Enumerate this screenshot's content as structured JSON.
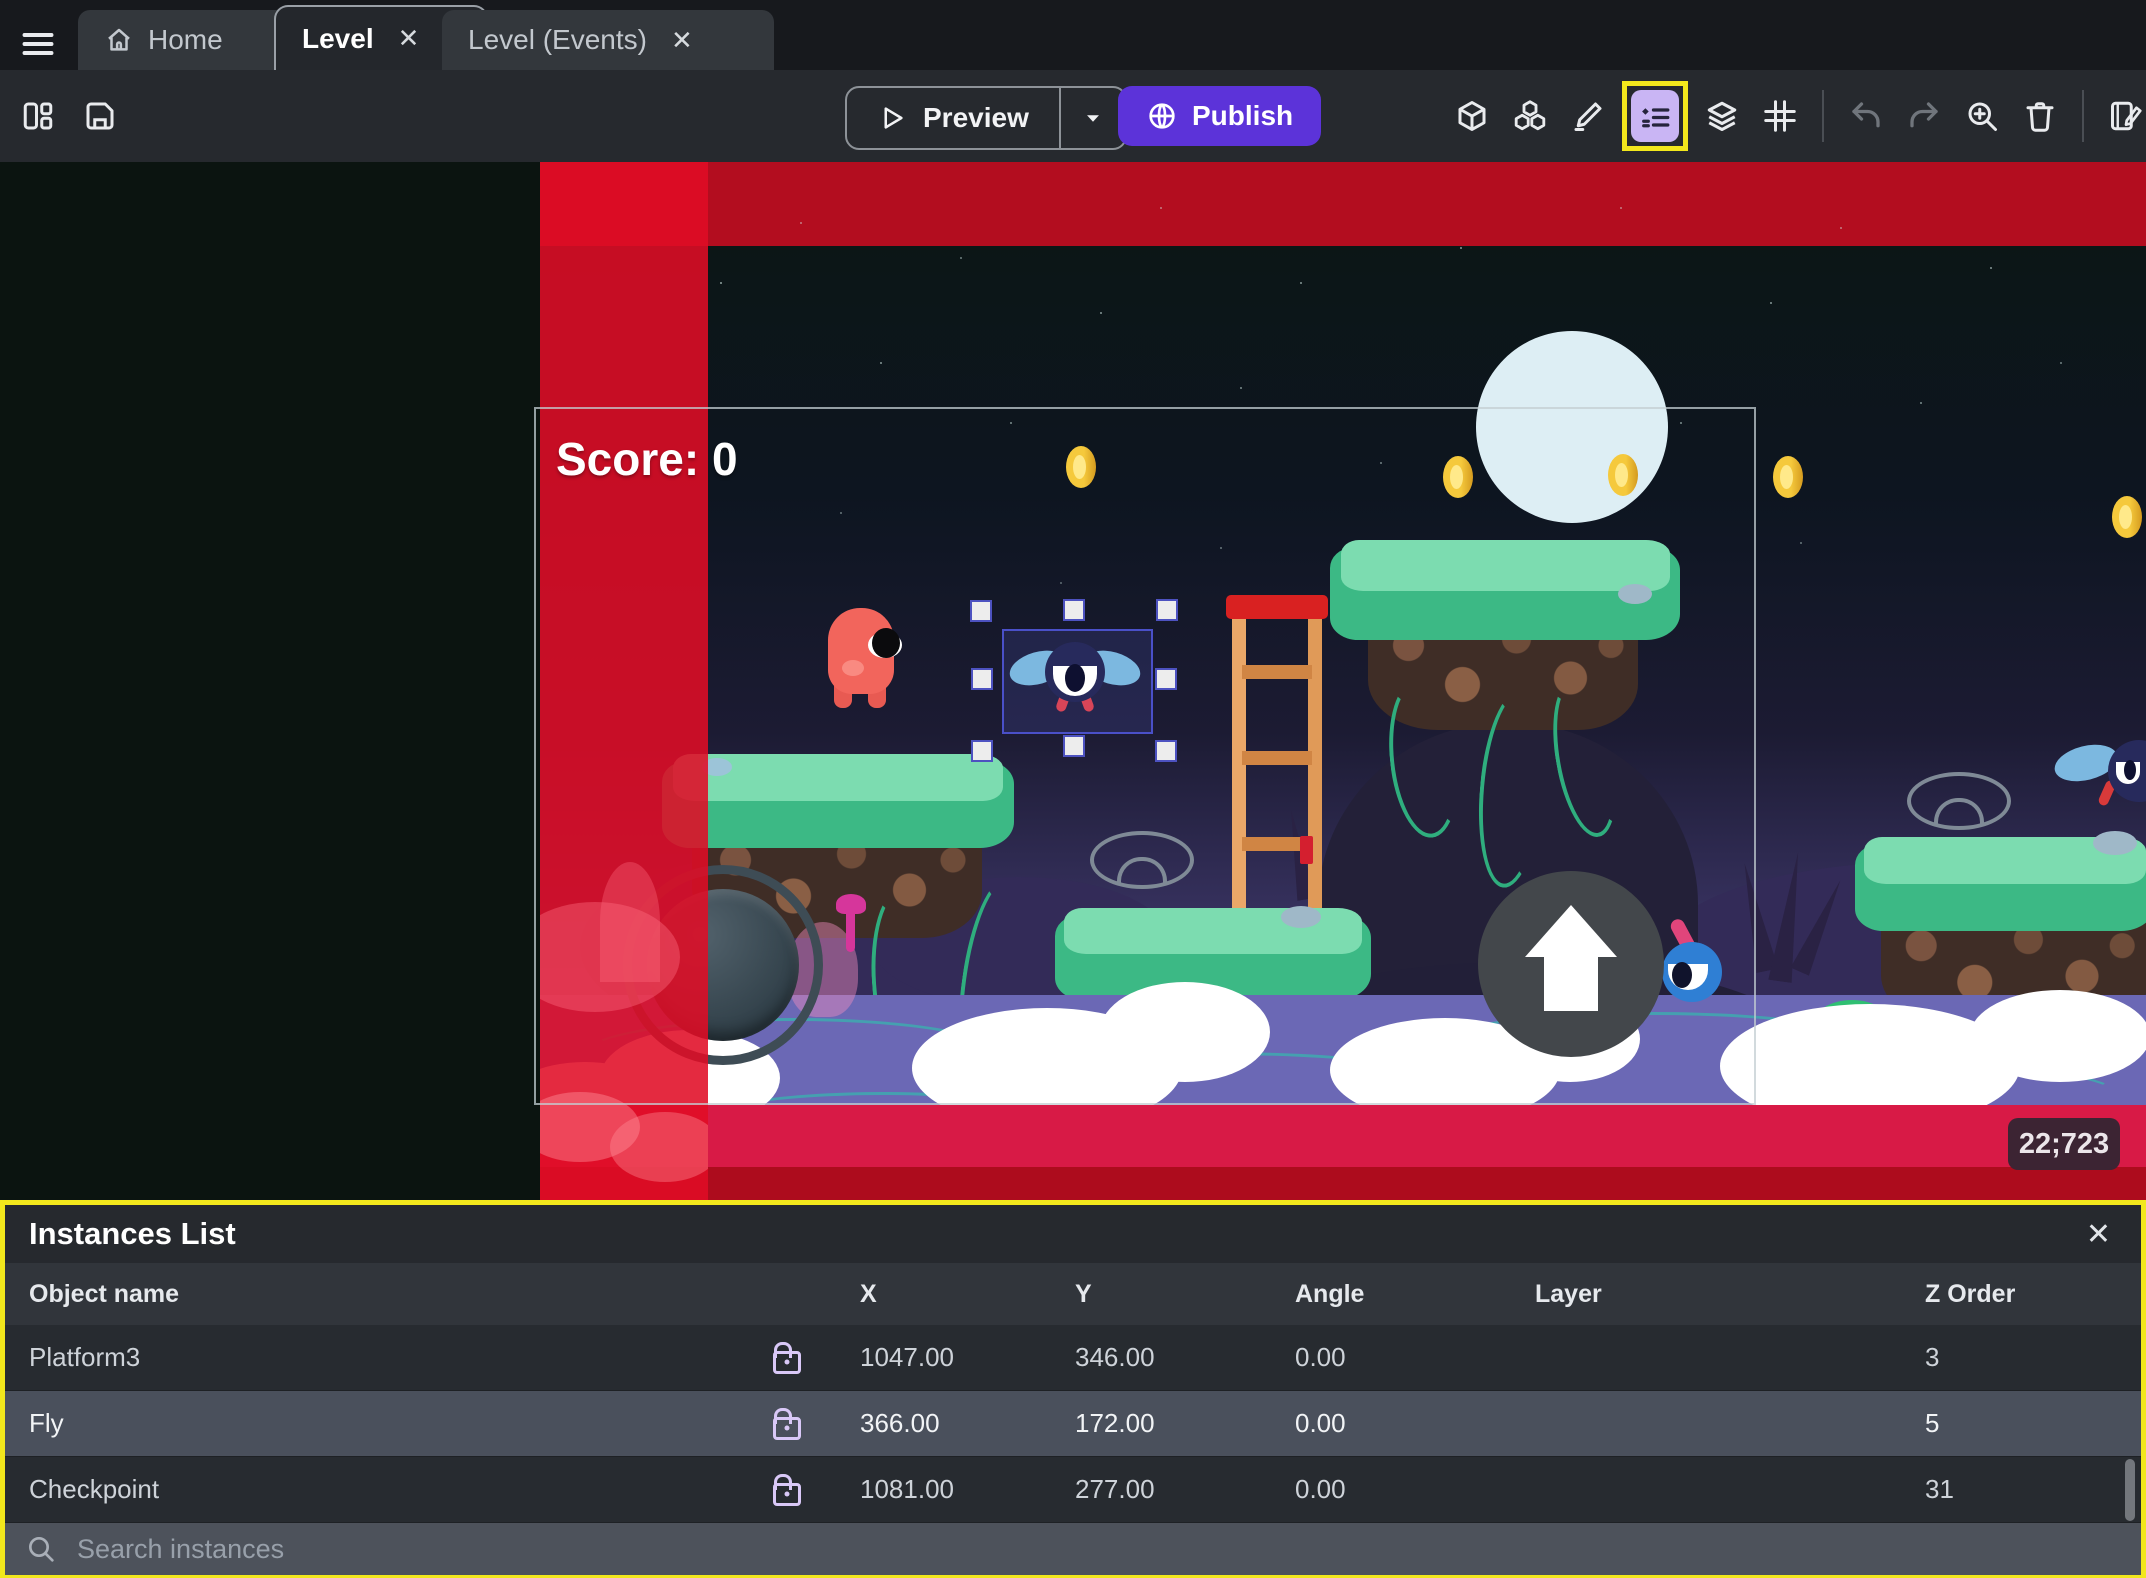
{
  "tabbar": {
    "tabs": [
      {
        "label": "Home"
      },
      {
        "label": "Level"
      },
      {
        "label": "Level (Events)"
      }
    ],
    "close_glyph": "✕"
  },
  "toolbar": {
    "preview_label": "Preview",
    "publish_label": "Publish"
  },
  "canvas": {
    "score_text": "Score: 0",
    "position_badge": "22;723"
  },
  "panel": {
    "title": "Instances List",
    "close_glyph": "✕",
    "columns": [
      "Object name",
      "X",
      "Y",
      "Angle",
      "Layer",
      "Z Order"
    ],
    "rows": [
      {
        "name": "Platform3",
        "x": "1047.00",
        "y": "346.00",
        "angle": "0.00",
        "layer": "",
        "z_order": "3"
      },
      {
        "name": "Fly",
        "x": "366.00",
        "y": "172.00",
        "angle": "0.00",
        "layer": "",
        "z_order": "5"
      },
      {
        "name": "Checkpoint",
        "x": "1081.00",
        "y": "277.00",
        "angle": "0.00",
        "layer": "",
        "z_order": "31"
      }
    ],
    "search_placeholder": "Search instances"
  },
  "colors": {
    "publish_button": "#5c33d9",
    "instances_active_bg": "#c9b5f4",
    "annotation_highlight": "#f2e71c",
    "selection_blue": "#4a50c8",
    "red_band": "#e00d26"
  }
}
